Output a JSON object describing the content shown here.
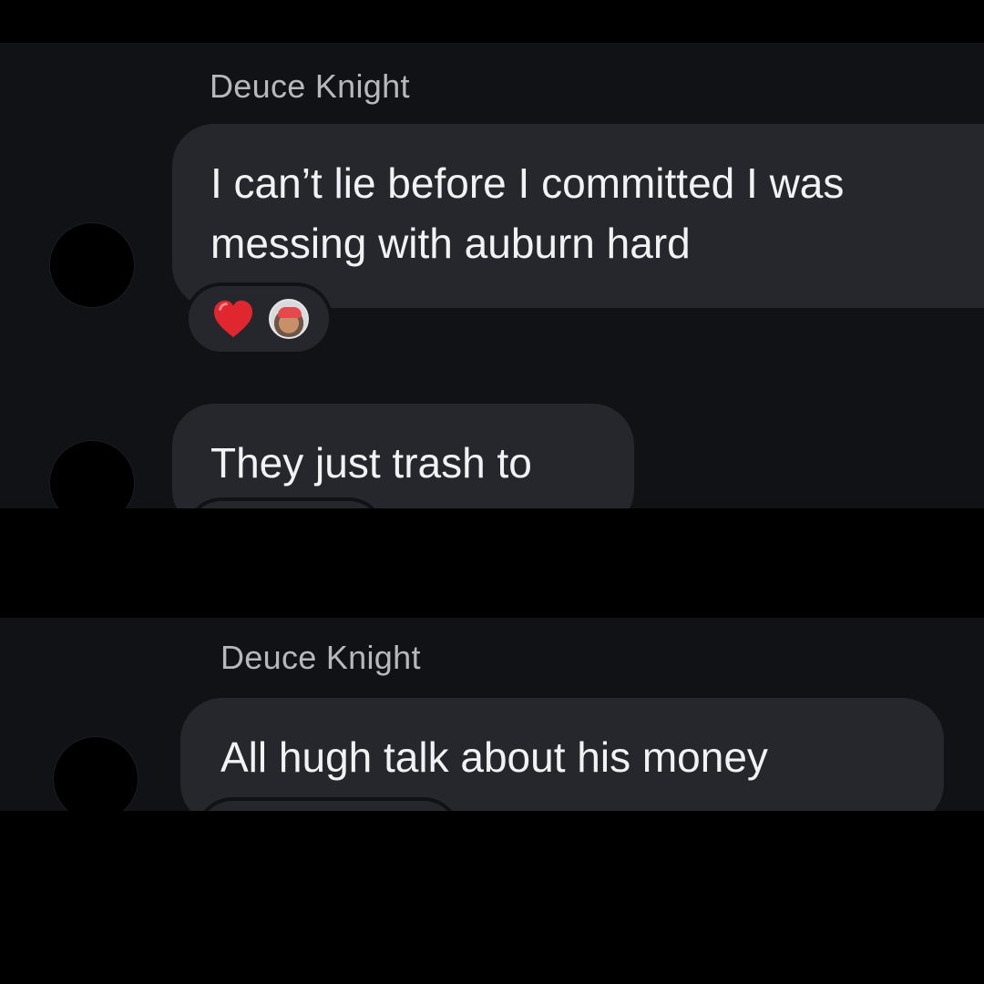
{
  "conversation": {
    "messages_group_1": {
      "sender": "Deuce Knight",
      "message_1": {
        "lines": [
          "I can’t lie before I committed I was",
          "messing with auburn hard"
        ],
        "reactions": [
          "heart-emoji",
          "reactor-avatar"
        ]
      },
      "message_2": {
        "text": "They just trash to"
      }
    },
    "messages_group_2": {
      "sender": "Deuce Knight",
      "message_1": {
        "text": "All hugh talk about his money"
      }
    }
  },
  "colors": {
    "background": "#000000",
    "panel": "#111216",
    "bubble": "#26272c",
    "text": "#f2f2f4",
    "sender_text": "#b7b8bc",
    "heart": "#e0262e"
  }
}
